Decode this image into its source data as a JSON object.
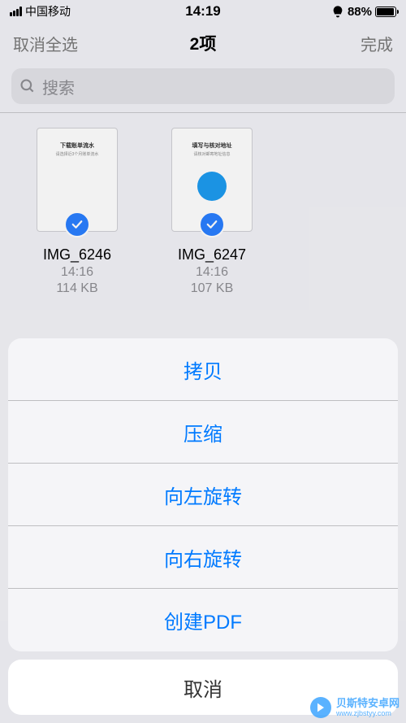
{
  "statusBar": {
    "carrier": "中国移动",
    "time": "14:19",
    "alarmIcon": "alarm",
    "battery": "88%"
  },
  "nav": {
    "left": "取消全选",
    "title": "2项",
    "right": "完成"
  },
  "search": {
    "placeholder": "搜索"
  },
  "files": [
    {
      "name": "IMG_6246",
      "time": "14:16",
      "size": "114 KB"
    },
    {
      "name": "IMG_6247",
      "time": "14:16",
      "size": "107 KB"
    }
  ],
  "actionSheet": {
    "items": [
      "拷贝",
      "压缩",
      "向左旋转",
      "向右旋转",
      "创建PDF"
    ],
    "cancel": "取消"
  },
  "watermark": {
    "name": "贝斯特安卓网",
    "url": "www.zjbstyy.com"
  }
}
